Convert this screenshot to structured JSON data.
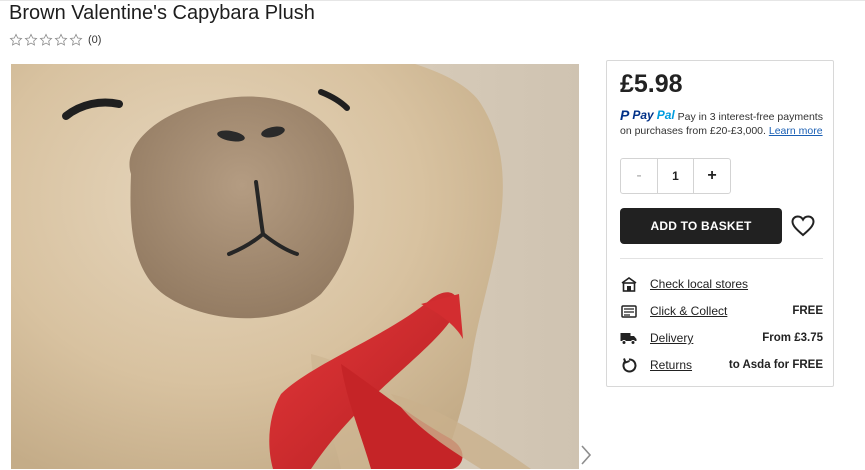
{
  "product": {
    "title": "Brown Valentine's Capybara Plush",
    "rating_count": "(0)",
    "rating_value": 0,
    "rating_max": 5
  },
  "gallery": {
    "image_description": "Close-up of a brown capybara plush with a red ribbon",
    "next_icon": "chevron-right-icon"
  },
  "purchase": {
    "price": "£5.98",
    "paypal": {
      "brand_p": "P",
      "brand_pay": "Pay",
      "brand_pal": "Pal",
      "message": "Pay in 3 interest-free payments on purchases from £20-£3,000.",
      "link": "Learn more"
    },
    "quantity": {
      "minus": "-",
      "value": "1",
      "plus": "+"
    },
    "add_to_basket": "ADD TO BASKET",
    "wishlist_icon": "heart-icon"
  },
  "fulfilment": [
    {
      "icon": "store-icon",
      "label": "Check local stores",
      "value": ""
    },
    {
      "icon": "click-collect-icon",
      "label": "Click & Collect",
      "value": "FREE"
    },
    {
      "icon": "truck-icon",
      "label": "Delivery",
      "value": "From £3.75"
    },
    {
      "icon": "returns-icon",
      "label": "Returns",
      "value": "to Asda for FREE"
    }
  ],
  "colors": {
    "button_dark": "#212121",
    "paypal_dark": "#003087",
    "paypal_light": "#009cde",
    "link": "#1a5fb4",
    "ribbon": "#d42a2e"
  }
}
